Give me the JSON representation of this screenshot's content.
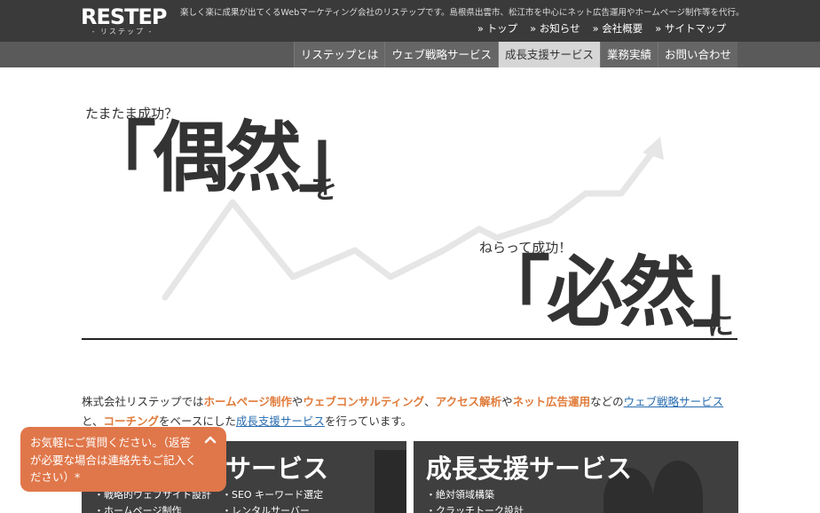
{
  "header": {
    "logo": "RESTEP",
    "logo_sub": "- リステップ -",
    "tagline": "楽しく楽に成果が出てくるWebマーケティング会社のリステップです。島根県出雲市、松江市を中心にネット広告運用やホームページ制作等を代行。",
    "util_nav": [
      "トップ",
      "お知らせ",
      "会社概要",
      "サイトマップ"
    ]
  },
  "main_nav": [
    {
      "label": "リステップとは",
      "light": false
    },
    {
      "label": "ウェブ戦略サービス",
      "light": false
    },
    {
      "label": "成長支援サービス",
      "light": true
    },
    {
      "label": "業務実績",
      "light": false
    },
    {
      "label": "お問い合わせ",
      "light": false
    }
  ],
  "hero": {
    "line1_small": "たまたま成功？",
    "line1_big": "「偶然」",
    "line1_particle": "を",
    "line2_small": "ねらって成功！",
    "line2_big": "「必然」",
    "line2_particle": "に"
  },
  "intro": {
    "t1": "株式会社リステップでは",
    "h1": "ホームページ制作",
    "t2": "や",
    "h2": "ウェブコンサルティング",
    "t3": "、",
    "h3": "アクセス解析",
    "t4": "や",
    "h4": "ネット広告運用",
    "t5": "などの",
    "l1": "ウェブ戦略サービス",
    "t6": "と、",
    "h5": "コーチング",
    "t7": "をベースにした",
    "l2": "成長支援サービス",
    "t8": "を行っています。"
  },
  "boxes": {
    "web": {
      "title": "サービス",
      "col1": [
        "戦略的ウェブサイト設計",
        "ホームページ制作"
      ],
      "col2": [
        "SEO キーワード選定",
        "レンタルサーバー"
      ]
    },
    "growth": {
      "title": "成長支援サービス",
      "col1": [
        "絶対領域構築",
        "クラッチトーク設計"
      ]
    }
  },
  "chat": {
    "text": "お気軽にご質問ください。（返答が必要な場合は連絡先もご記入ください）*"
  },
  "colors": {
    "header_bg": "#3a3a3a",
    "nav_bg": "#5a5a5a",
    "accent_orange": "#e07b3a",
    "link_blue": "#2a6db0",
    "chat_bg": "#e0774a"
  }
}
